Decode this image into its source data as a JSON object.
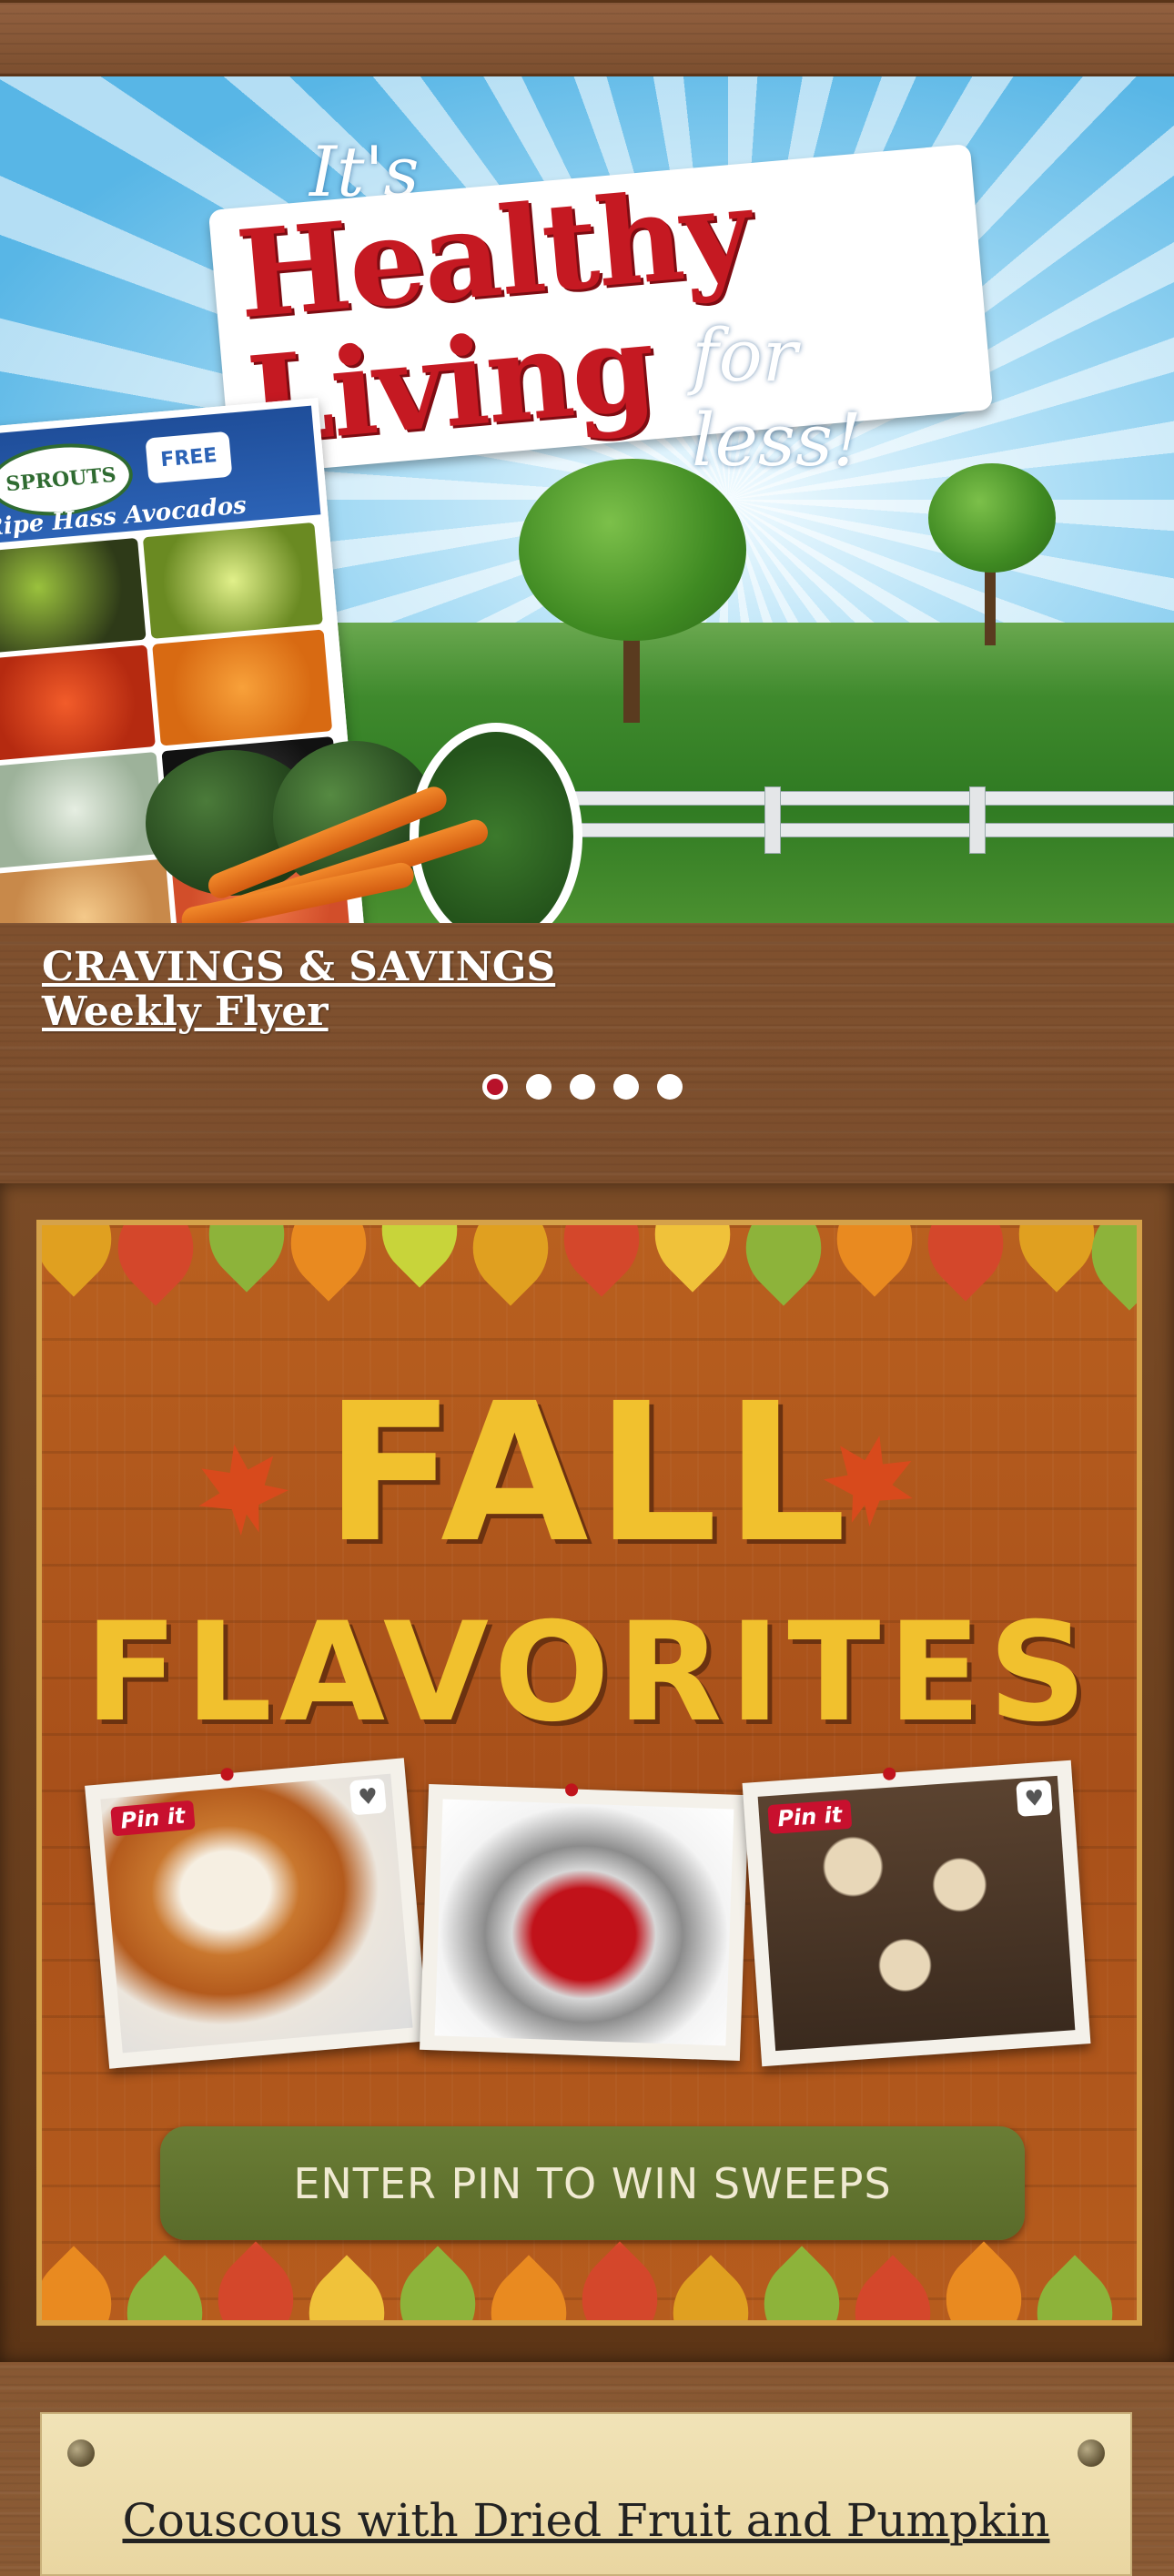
{
  "hero": {
    "logo": {
      "line1": "It's",
      "line2": "Healthy Living",
      "line3": "for less!"
    },
    "flyer": {
      "brand": "SPROUTS",
      "badge": "FREE",
      "headline": "Ripe Hass Avocados"
    },
    "caption": {
      "line1": "CRAVINGS & SAVINGS",
      "line2": "Weekly Flyer"
    },
    "carousel": {
      "slide_count": 5,
      "active_index": 0
    }
  },
  "promo": {
    "title_line1": "FALL",
    "title_line2": "FLAVORITES",
    "cards": [
      {
        "image": "pumpkin-pie",
        "pin_label": "Pin it",
        "heart": "♥"
      },
      {
        "image": "stand-mixer"
      },
      {
        "image": "roasted-pears",
        "pin_label": "Pin it",
        "heart": "♥"
      }
    ],
    "cta_label": "ENTER PIN TO WIN SWEEPS"
  },
  "recipe": {
    "title": "Couscous with Dried Fruit and Pumpkin"
  },
  "colors": {
    "wood": "#7b4d2c",
    "brand_red": "#c51922",
    "fall_yellow": "#f1c12e",
    "cta_green": "#5a6b2a",
    "dot_active": "#b8122a"
  }
}
